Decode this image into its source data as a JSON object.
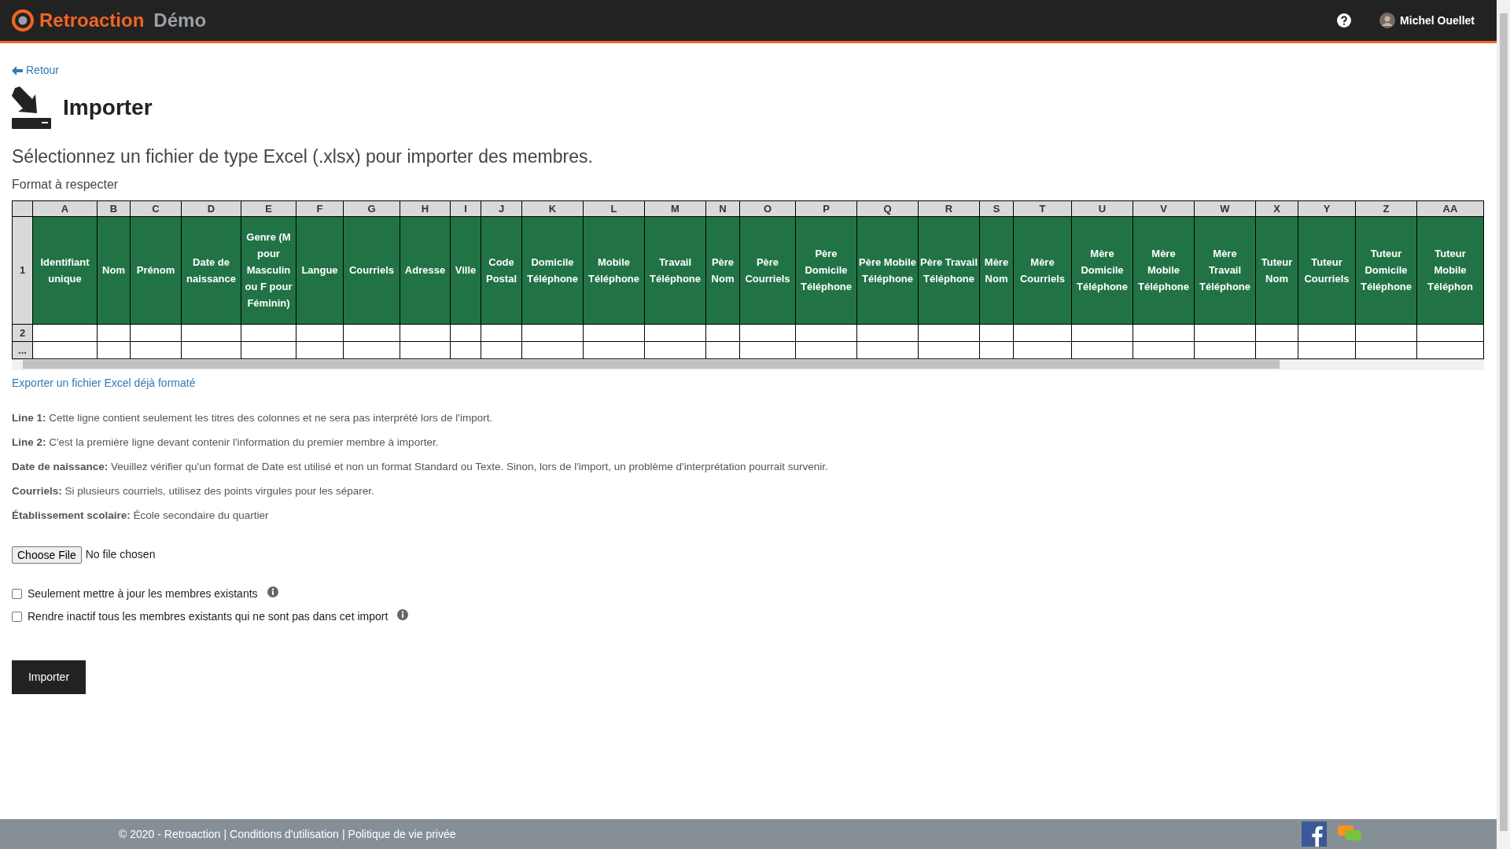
{
  "header": {
    "brand": "Retroaction",
    "brand_suffix": "Démo",
    "user": "Michel Ouellet"
  },
  "back_link": "Retour",
  "title": "Importer",
  "subtitle": "Sélectionnez un fichier de type Excel (.xlsx) pour importer des membres.",
  "format_label": "Format à respecter",
  "table": {
    "row_numbers": [
      "1",
      "2",
      "..."
    ],
    "columns": [
      {
        "letter": "A",
        "title": "Identifiant unique"
      },
      {
        "letter": "B",
        "title": "Nom"
      },
      {
        "letter": "C",
        "title": "Prénom"
      },
      {
        "letter": "D",
        "title": "Date de naissance"
      },
      {
        "letter": "E",
        "title": "Genre (M pour Masculin ou F pour Féminin)"
      },
      {
        "letter": "F",
        "title": "Langue"
      },
      {
        "letter": "G",
        "title": "Courriels"
      },
      {
        "letter": "H",
        "title": "Adresse"
      },
      {
        "letter": "I",
        "title": "Ville"
      },
      {
        "letter": "J",
        "title": "Code Postal"
      },
      {
        "letter": "K",
        "title": "Domicile Téléphone"
      },
      {
        "letter": "L",
        "title": "Mobile Téléphone"
      },
      {
        "letter": "M",
        "title": "Travail Téléphone"
      },
      {
        "letter": "N",
        "title": "Père Nom"
      },
      {
        "letter": "O",
        "title": "Père Courriels"
      },
      {
        "letter": "P",
        "title": "Père Domicile Téléphone"
      },
      {
        "letter": "Q",
        "title": "Père Mobile Téléphone"
      },
      {
        "letter": "R",
        "title": "Père Travail Téléphone"
      },
      {
        "letter": "S",
        "title": "Mère Nom"
      },
      {
        "letter": "T",
        "title": "Mère Courriels"
      },
      {
        "letter": "U",
        "title": "Mère Domicile Téléphone"
      },
      {
        "letter": "V",
        "title": "Mère Mobile Téléphone"
      },
      {
        "letter": "W",
        "title": "Mère Travail Téléphone"
      },
      {
        "letter": "X",
        "title": "Tuteur Nom"
      },
      {
        "letter": "Y",
        "title": "Tuteur Courriels"
      },
      {
        "letter": "Z",
        "title": "Tuteur Domicile Téléphone"
      },
      {
        "letter": "AA",
        "title": "Tuteur Mobile Téléphon"
      }
    ]
  },
  "export_link": "Exporter un fichier Excel déjà formaté",
  "notes": [
    "**Line 1:** Cette ligne contient seulement les titres des colonnes et ne sera pas interprété lors de l'import.",
    "**Line 2:** C'est la première ligne devant contenir l'information du premier membre à importer.",
    "**Date de naissance:** Veuillez vérifier qu'un format de Date est utilisé et non un format Standard ou Texte. Sinon, lors de l'import, un problème d'interprétation pourrait survenir.",
    "**Courriels:** Si plusieurs courriels, utilisez des points virgules pour les séparer.",
    "**Établissement scolaire:** École secondaire du quartier"
  ],
  "file_input": {
    "button": "Choose File",
    "status": "No file chosen"
  },
  "options": [
    {
      "label": "Seulement mettre à jour les membres existants",
      "checked": false
    },
    {
      "label": "Rendre inactif tous les membres existants qui ne sont pas dans cet import",
      "checked": false
    }
  ],
  "submit": "Importer",
  "footer": {
    "copyright": "© 2020 - Retroaction",
    "separator": "|",
    "links": [
      "Conditions d'utilisation",
      "Politique de vie privée"
    ]
  }
}
